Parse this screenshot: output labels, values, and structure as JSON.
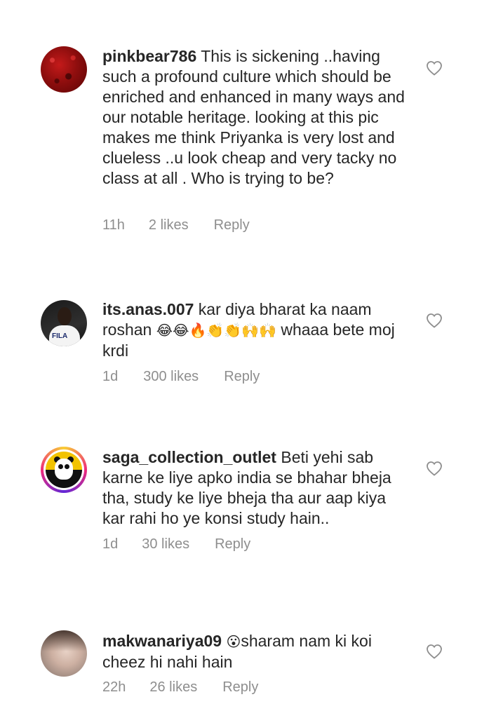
{
  "comments": [
    {
      "username": "pinkbear786",
      "text": " This is sickening ..having such a profound culture which should be enriched and enhanced in many ways and our notable heritage. looking at this pic makes me think Priyanka is very lost and clueless ..u look cheap and very tacky no class at all . Who is trying to be?",
      "time": "11h",
      "likes": "2 likes",
      "reply": "Reply",
      "avatar_icon": "red-texture-avatar"
    },
    {
      "username": "its.anas.007",
      "text_before": " kar diya bharat ka naam roshan ",
      "emojis": "😂😂🔥👏👏🙌🙌",
      "text_after": " whaaa bete moj krdi",
      "time": "1d",
      "likes": "300 likes",
      "reply": "Reply",
      "avatar_icon": "person-avatar",
      "avatar_text": "FILA"
    },
    {
      "username": "saga_collection_outlet",
      "text": " Beti yehi sab karne ke liye apko india se bhahar bheja tha, study ke liye bheja tha aur aap kiya kar rahi ho ye konsi study hain..",
      "time": "1d",
      "likes": "30 likes",
      "reply": "Reply",
      "avatar_icon": "panda-logo-avatar"
    },
    {
      "username": "makwanariya09",
      "emoji": "😮",
      "text": "sharam nam ki koi cheez hi nahi hain",
      "time": "22h",
      "likes": "26 likes",
      "reply": "Reply",
      "avatar_icon": "photo-avatar"
    }
  ],
  "colors": {
    "text": "#262626",
    "meta": "#8e8e8e",
    "heart": "#8e8e8e"
  }
}
